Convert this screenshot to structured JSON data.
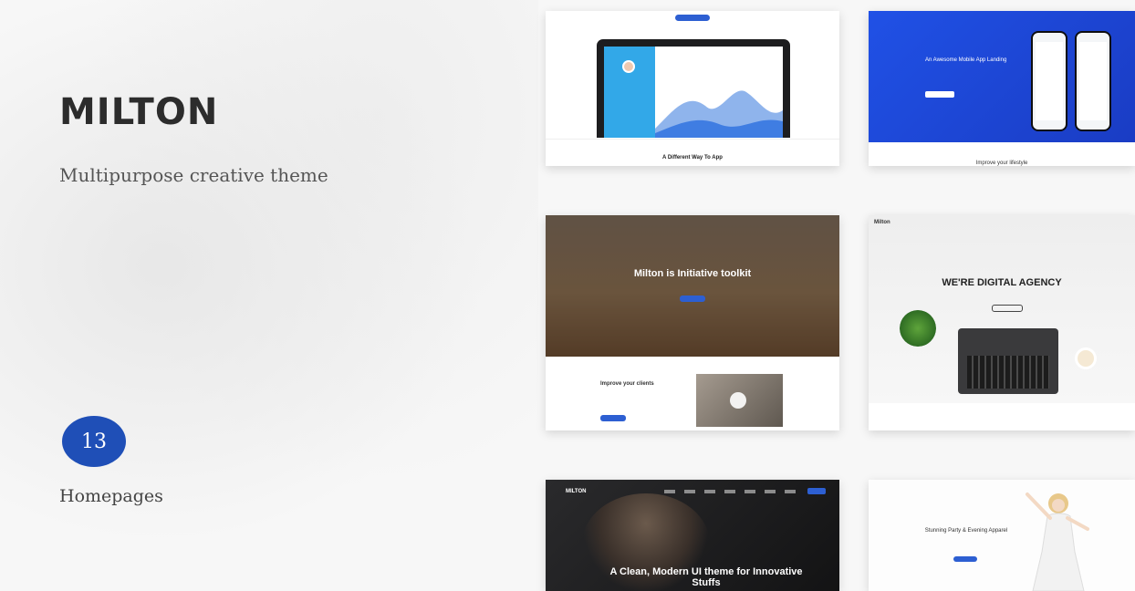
{
  "brand": {
    "name": "MILTON",
    "tagline": "Multipurpose creative theme"
  },
  "homepages": {
    "count": "13",
    "label": "Homepages"
  },
  "previews": [
    {
      "id": "app",
      "caption": "A Different Way To App",
      "accent": "#2d5fd2",
      "sidebar_color": "#32a8e8"
    },
    {
      "id": "mobile",
      "headline": "An Awesome Mobile App Landing",
      "bottom_caption": "Improve your lifestyle",
      "color": "#2051e6"
    },
    {
      "id": "toolkit",
      "headline": "Milton is Initiative toolkit",
      "sub_heading": "Improve your clients"
    },
    {
      "id": "agency",
      "logo": "Milton",
      "headline": "WE'RE DIGITAL AGENCY"
    },
    {
      "id": "dark",
      "logo": "MILTON",
      "headline": "A Clean, Modern UI theme for Innovative Stuffs"
    },
    {
      "id": "fashion",
      "headline": "Stunning Party & Evening Apparel"
    }
  ],
  "icons": [
    "play-icon"
  ]
}
